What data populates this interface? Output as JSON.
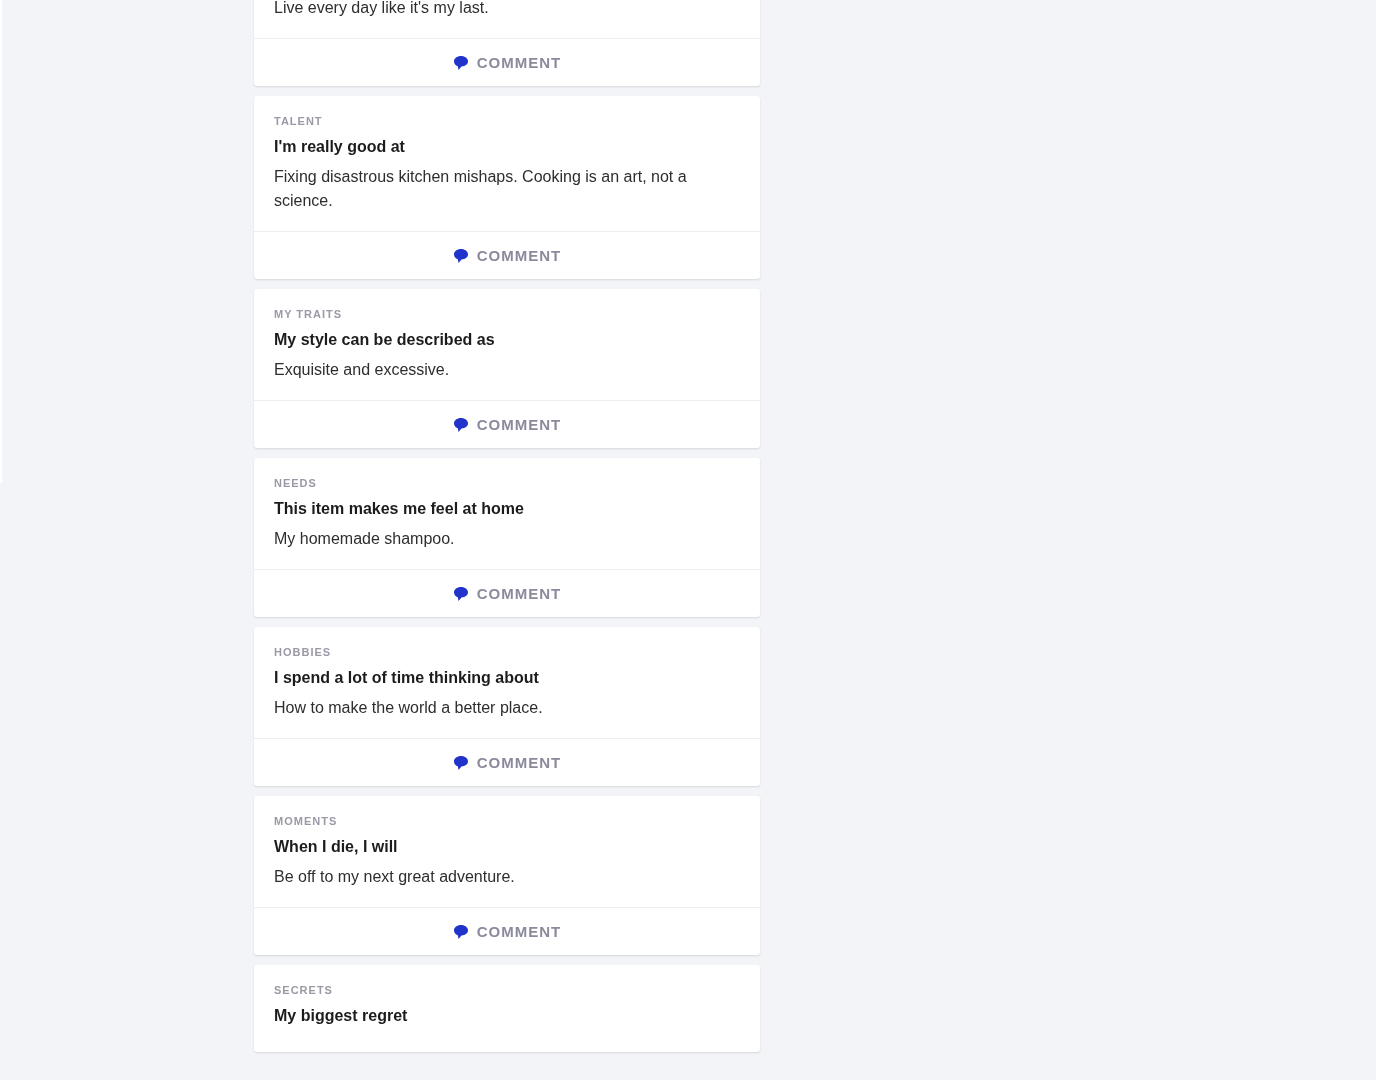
{
  "cards": [
    {
      "answer": "Live every day like it's my last.",
      "comment": "COMMENT"
    },
    {
      "category": "TALENT",
      "question": "I'm really good at",
      "answer": "Fixing disastrous kitchen mishaps. Cooking is an art, not a science.",
      "comment": "COMMENT"
    },
    {
      "category": "MY TRAITS",
      "question": "My style can be described as",
      "answer": "Exquisite and excessive.",
      "comment": "COMMENT"
    },
    {
      "category": "NEEDS",
      "question": "This item makes me feel at home",
      "answer": "My homemade shampoo.",
      "comment": "COMMENT"
    },
    {
      "category": "HOBBIES",
      "question": "I spend a lot of time thinking about",
      "answer": "How to make the world a better place.",
      "comment": "COMMENT"
    },
    {
      "category": "MOMENTS",
      "question": "When I die, I will",
      "answer": "Be off to my next great adventure.",
      "comment": "COMMENT"
    },
    {
      "category": "SECRETS",
      "question": "My biggest regret"
    }
  ]
}
